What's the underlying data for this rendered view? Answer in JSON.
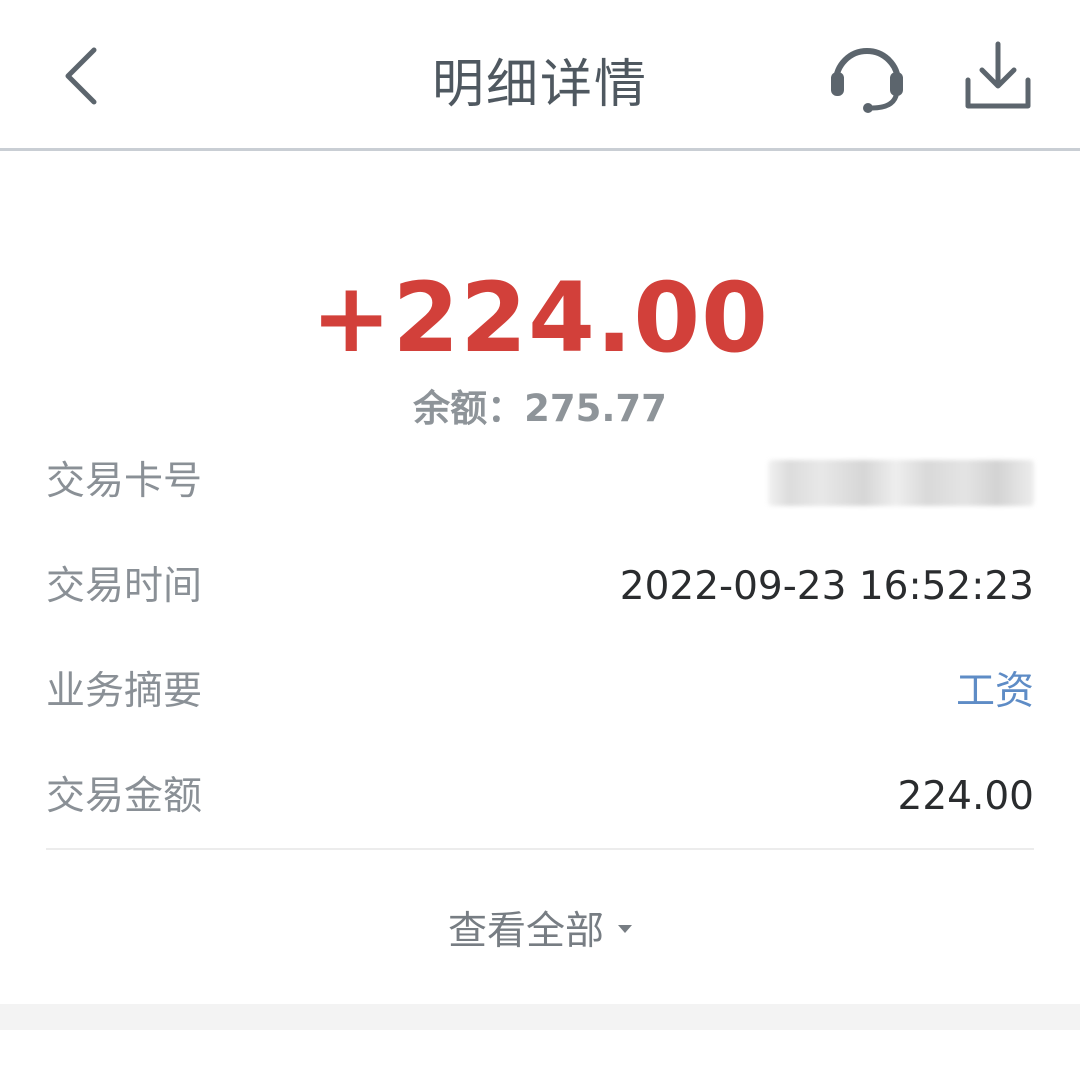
{
  "header": {
    "title": "明细详情",
    "back_icon": "chevron-left-icon",
    "service_icon": "headset-icon",
    "download_icon": "download-icon"
  },
  "summary": {
    "amount": "+224.00",
    "balance": "余额：275.77",
    "amount_color": "#d2403a"
  },
  "details": [
    {
      "label": "交易卡号",
      "value": ""
    },
    {
      "label": "交易时间",
      "value": "2022-09-23 16:52:23"
    },
    {
      "label": "业务摘要",
      "value": "工资"
    },
    {
      "label": "交易金额",
      "value": "224.00"
    }
  ],
  "view_all": {
    "label": "查看全部"
  },
  "colors": {
    "link": "#5e8cc6",
    "label": "#8a9096",
    "header_text": "#4f5860"
  }
}
